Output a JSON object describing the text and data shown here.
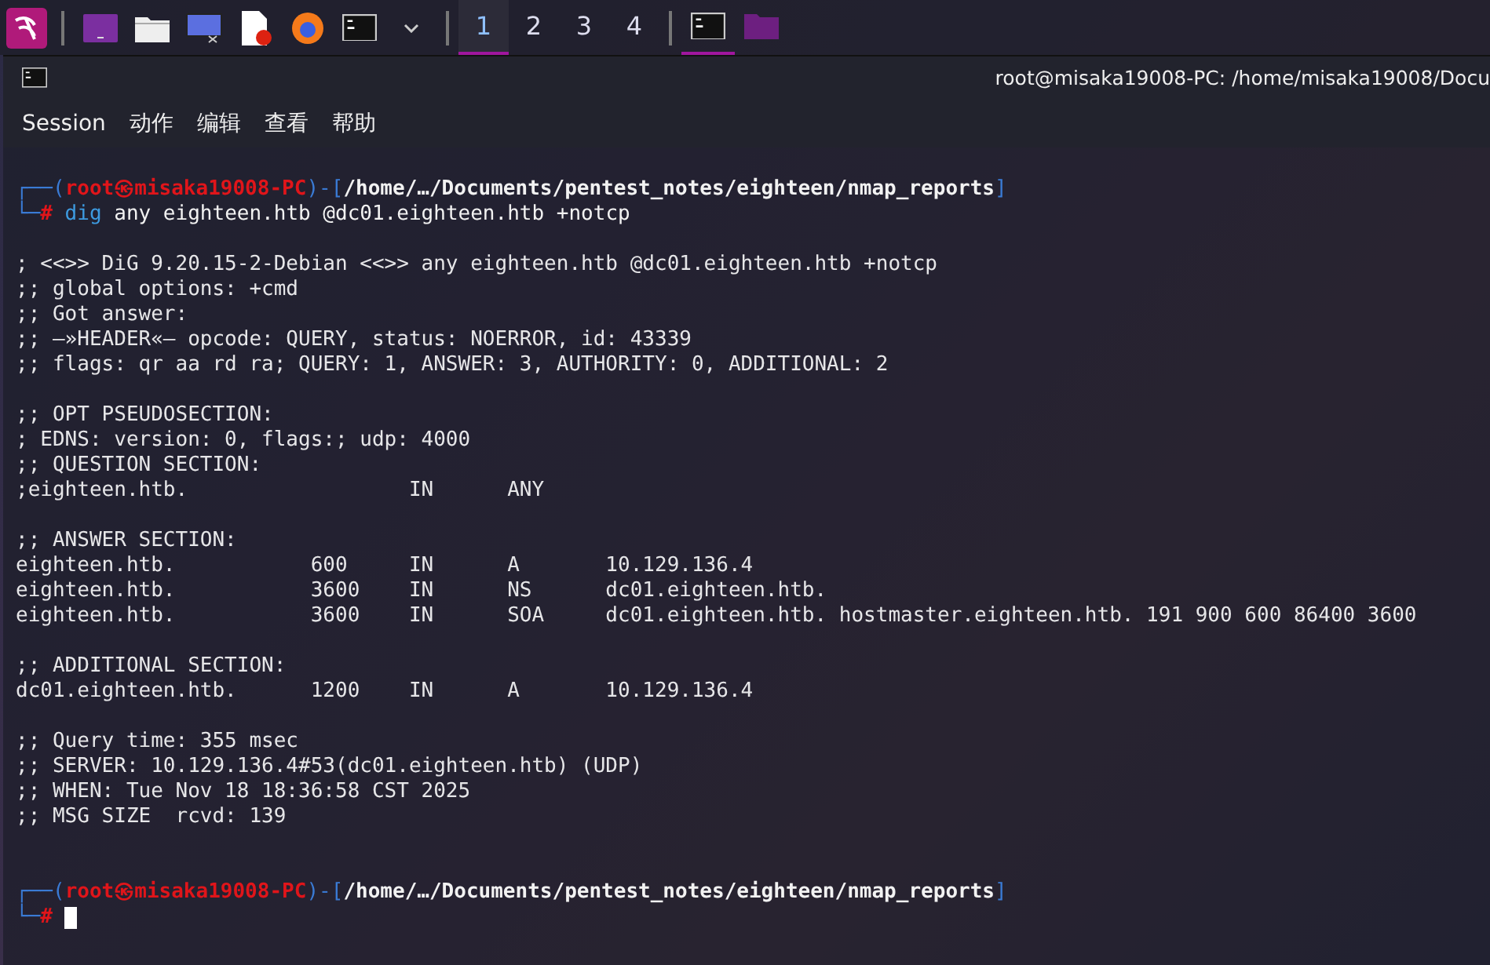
{
  "taskbar": {
    "launchers": [
      {
        "kind": "kali"
      },
      {
        "kind": "window"
      },
      {
        "kind": "folder"
      },
      {
        "kind": "screen"
      },
      {
        "kind": "document"
      },
      {
        "kind": "browser"
      },
      {
        "kind": "terminal"
      },
      {
        "kind": "caret"
      }
    ],
    "workspaces": [
      {
        "label": "1",
        "selected": true
      },
      {
        "label": "2",
        "selected": false
      },
      {
        "label": "3",
        "selected": false
      },
      {
        "label": "4",
        "selected": false
      }
    ],
    "tasks": [
      {
        "kind": "terminal",
        "selected": true
      },
      {
        "kind": "folder",
        "selected": false
      }
    ]
  },
  "window": {
    "title": "root@misaka19008-PC: /home/misaka19008/Docu"
  },
  "menu": [
    "Session",
    "动作",
    "编辑",
    "查看",
    "帮助"
  ],
  "lines": [
    {
      "kind": "prompt",
      "frame": "┌──(",
      "user": "root㉿misaka19008-PC",
      "mid": ")-[",
      "path": "/home/…/Documents/pentest_notes/eighteen/nmap_reports",
      "end": "]"
    },
    {
      "kind": "command",
      "frame": "└─",
      "symbol": "#",
      "program": "dig",
      "args": "any eighteen.htb @dc01.eighteen.htb +notcp",
      "cursor": false
    },
    {
      "kind": "blank"
    },
    {
      "kind": "text",
      "text": "; <<>> DiG 9.20.15-2-Debian <<>> any eighteen.htb @dc01.eighteen.htb +notcp"
    },
    {
      "kind": "text",
      "text": ";; global options: +cmd"
    },
    {
      "kind": "text",
      "text": ";; Got answer:"
    },
    {
      "kind": "text",
      "text": ";; —»HEADER«— opcode: QUERY, status: NOERROR, id: 43339"
    },
    {
      "kind": "text",
      "text": ";; flags: qr aa rd ra; QUERY: 1, ANSWER: 3, AUTHORITY: 0, ADDITIONAL: 2"
    },
    {
      "kind": "blank"
    },
    {
      "kind": "text",
      "text": ";; OPT PSEUDOSECTION:"
    },
    {
      "kind": "text",
      "text": "; EDNS: version: 0, flags:; udp: 4000"
    },
    {
      "kind": "text",
      "text": ";; QUESTION SECTION:"
    },
    {
      "kind": "text",
      "text": ";eighteen.htb.                  IN      ANY"
    },
    {
      "kind": "blank"
    },
    {
      "kind": "text",
      "text": ";; ANSWER SECTION:"
    },
    {
      "kind": "text",
      "text": "eighteen.htb.           600     IN      A       10.129.136.4"
    },
    {
      "kind": "text",
      "text": "eighteen.htb.           3600    IN      NS      dc01.eighteen.htb."
    },
    {
      "kind": "text",
      "text": "eighteen.htb.           3600    IN      SOA     dc01.eighteen.htb. hostmaster.eighteen.htb. 191 900 600 86400 3600"
    },
    {
      "kind": "blank"
    },
    {
      "kind": "text",
      "text": ";; ADDITIONAL SECTION:"
    },
    {
      "kind": "text",
      "text": "dc01.eighteen.htb.      1200    IN      A       10.129.136.4"
    },
    {
      "kind": "blank"
    },
    {
      "kind": "text",
      "text": ";; Query time: 355 msec"
    },
    {
      "kind": "text",
      "text": ";; SERVER: 10.129.136.4#53(dc01.eighteen.htb) (UDP)"
    },
    {
      "kind": "text",
      "text": ";; WHEN: Tue Nov 18 18:36:58 CST 2025"
    },
    {
      "kind": "text",
      "text": ";; MSG SIZE  rcvd: 139"
    },
    {
      "kind": "blank"
    },
    {
      "kind": "blank"
    },
    {
      "kind": "prompt",
      "frame": "┌──(",
      "user": "root㉿misaka19008-PC",
      "mid": ")-[",
      "path": "/home/…/Documents/pentest_notes/eighteen/nmap_reports",
      "end": "]"
    },
    {
      "kind": "command",
      "frame": "└─",
      "symbol": "#",
      "cursor": true
    }
  ]
}
